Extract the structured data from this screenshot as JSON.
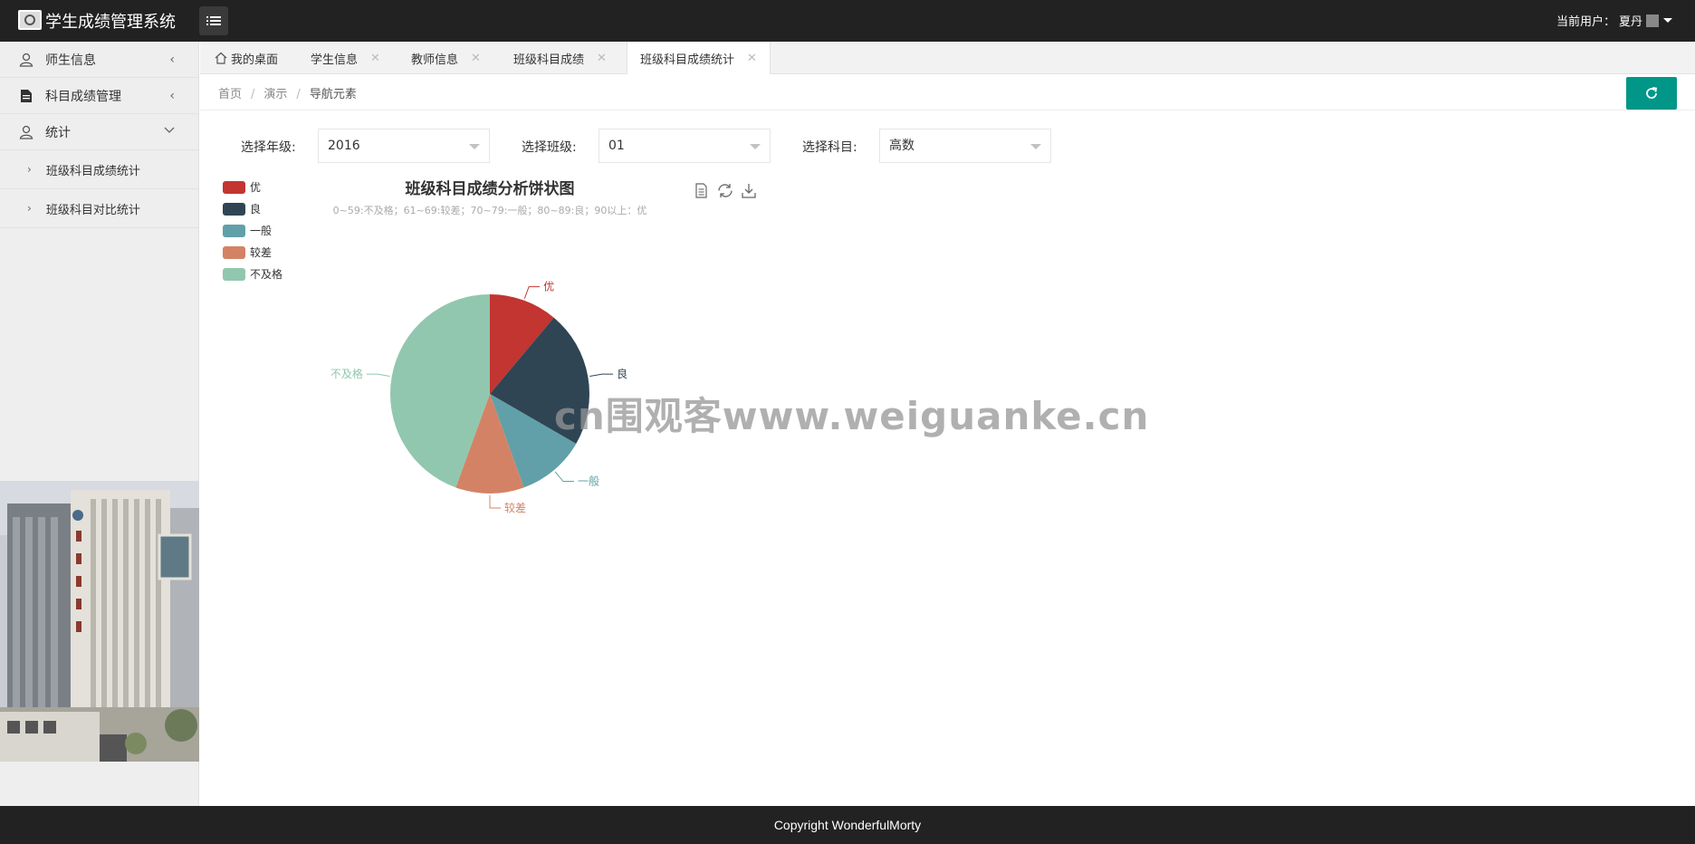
{
  "header": {
    "app_title": "学生成绩管理系统",
    "user_label": "当前用户：",
    "user_name": "夏丹"
  },
  "sidebar": {
    "items": [
      {
        "label": "师生信息",
        "icon": "user-icon",
        "expanded": false
      },
      {
        "label": "科目成绩管理",
        "icon": "document-icon",
        "expanded": false
      },
      {
        "label": "统计",
        "icon": "user-icon",
        "expanded": true
      }
    ],
    "sub_items": [
      "班级科目成绩统计",
      "班级科目对比统计"
    ]
  },
  "tabs": [
    {
      "label": "我的桌面",
      "closable": false,
      "active": false
    },
    {
      "label": "学生信息",
      "closable": true,
      "active": false
    },
    {
      "label": "教师信息",
      "closable": true,
      "active": false
    },
    {
      "label": "班级科目成绩",
      "closable": true,
      "active": false
    },
    {
      "label": "班级科目成绩统计",
      "closable": true,
      "active": true
    }
  ],
  "breadcrumb": [
    "首页",
    "演示",
    "导航元素"
  ],
  "filters": {
    "grade": {
      "label": "选择年级:",
      "value": "2016"
    },
    "class": {
      "label": "选择班级:",
      "value": "01"
    },
    "subject": {
      "label": "选择科目:",
      "value": "高数"
    }
  },
  "chart_data": {
    "type": "pie",
    "title": "班级科目成绩分析饼状图",
    "subtitle": "0~59:不及格；61~69:较差；70~79:一般；80~89:良；90以上：优",
    "legend_position": "top-left",
    "slices": [
      {
        "name": "优",
        "value": 10,
        "color": "#c23531"
      },
      {
        "name": "良",
        "value": 20,
        "color": "#2f4554"
      },
      {
        "name": "一般",
        "value": 10,
        "color": "#61a0a8"
      },
      {
        "name": "较差",
        "value": 10,
        "color": "#d48265"
      },
      {
        "name": "不及格",
        "value": 40,
        "color": "#91c7ae"
      }
    ]
  },
  "watermark": "cn围观客www.weiguanke.cn",
  "footer": {
    "copyright": "Copyright WonderfulMorty"
  },
  "colors": {
    "header_bg": "#222222",
    "accent": "#009688",
    "sidebar_bg": "#eeeeee"
  }
}
